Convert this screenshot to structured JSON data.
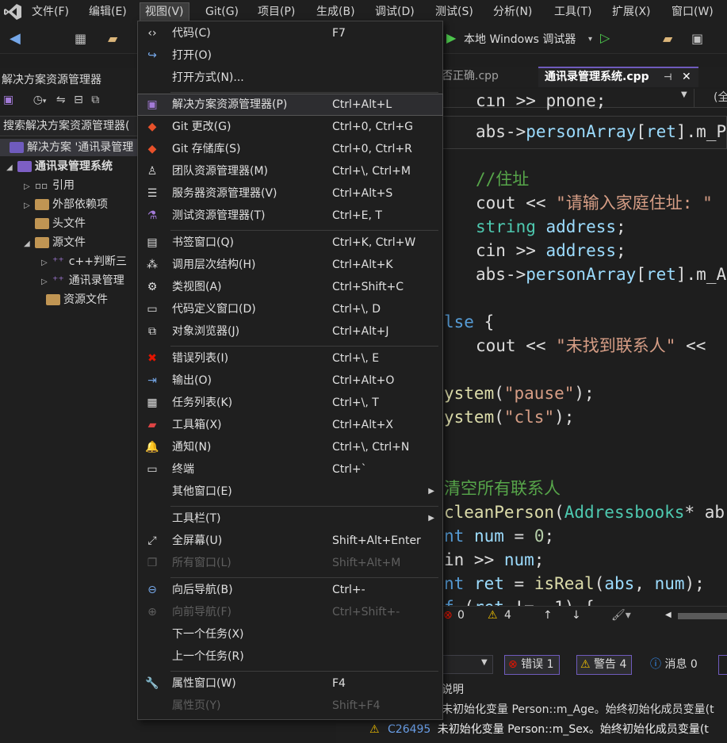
{
  "menubar": {
    "items": [
      "文件(F)",
      "编辑(E)",
      "视图(V)",
      "Git(G)",
      "项目(P)",
      "生成(B)",
      "调试(D)",
      "测试(S)",
      "分析(N)",
      "工具(T)",
      "扩展(X)",
      "窗口(W)"
    ],
    "active": "视图(V)"
  },
  "toolbar": {
    "debug_target": "本地 Windows 调试器"
  },
  "solution_explorer": {
    "title": "解决方案资源管理器",
    "search": "搜索解决方案资源管理器(",
    "tree": [
      {
        "label": "解决方案 '通讯录管理",
        "level": 0
      },
      {
        "label": "通讯录管理系统",
        "level": 1
      },
      {
        "label": "引用",
        "level": 2
      },
      {
        "label": "外部依赖项",
        "level": 2
      },
      {
        "label": "头文件",
        "level": 2
      },
      {
        "label": "源文件",
        "level": 2
      },
      {
        "label": "c++判断三",
        "level": 3
      },
      {
        "label": "通讯录管理",
        "level": 3
      },
      {
        "label": "资源文件",
        "level": 2
      }
    ]
  },
  "editor": {
    "tabs": [
      {
        "label": "否正确.cpp"
      },
      {
        "label": "通讯录管理系统.cpp"
      }
    ],
    "scope_right": "(全"
  },
  "error_bar": {
    "errors": "0",
    "warnings": "4"
  },
  "error_list": {
    "errors_btn": "错误 1",
    "warnings_btn": "警告 4",
    "messages_btn": "消息 0",
    "column_desc": "说明",
    "rows": [
      {
        "code": "",
        "desc": "未初始化变量 Person::m_Age。始终初始化成员变量(t"
      },
      {
        "code": "C26495",
        "desc": "未初始化变量 Person::m_Sex。始终初始化成员变量(t"
      }
    ]
  },
  "view_menu": {
    "items": [
      {
        "icon": "code-icon",
        "glyph": "‹›",
        "label": "代码(C)",
        "shortcut": "F7",
        "disabled": false
      },
      {
        "icon": "open-icon",
        "glyph": "↪",
        "label": "打开(O)",
        "shortcut": "",
        "disabled": false
      },
      {
        "icon": "",
        "glyph": "",
        "label": "打开方式(N)...",
        "shortcut": "",
        "disabled": false
      },
      {
        "sep": true
      },
      {
        "icon": "solution-explorer-icon",
        "glyph": "▣",
        "label": "解决方案资源管理器(P)",
        "shortcut": "Ctrl+Alt+L",
        "disabled": false,
        "highlight": true
      },
      {
        "icon": "git-changes-icon",
        "glyph": "◆",
        "label": "Git 更改(G)",
        "shortcut": "Ctrl+0, Ctrl+G",
        "disabled": false
      },
      {
        "icon": "git-repo-icon",
        "glyph": "◆",
        "label": "Git 存储库(S)",
        "shortcut": "Ctrl+0, Ctrl+R",
        "disabled": false
      },
      {
        "icon": "team-explorer-icon",
        "glyph": "♙",
        "label": "团队资源管理器(M)",
        "shortcut": "Ctrl+\\, Ctrl+M",
        "disabled": false
      },
      {
        "icon": "server-explorer-icon",
        "glyph": "☰",
        "label": "服务器资源管理器(V)",
        "shortcut": "Ctrl+Alt+S",
        "disabled": false
      },
      {
        "icon": "test-explorer-icon",
        "glyph": "⚗",
        "label": "测试资源管理器(T)",
        "shortcut": "Ctrl+E, T",
        "disabled": false
      },
      {
        "sep": true
      },
      {
        "icon": "bookmark-icon",
        "glyph": "▤",
        "label": "书签窗口(Q)",
        "shortcut": "Ctrl+K, Ctrl+W",
        "disabled": false
      },
      {
        "icon": "call-hierarchy-icon",
        "glyph": "⁂",
        "label": "调用层次结构(H)",
        "shortcut": "Ctrl+Alt+K",
        "disabled": false
      },
      {
        "icon": "class-view-icon",
        "glyph": "⚙",
        "label": "类视图(A)",
        "shortcut": "Ctrl+Shift+C",
        "disabled": false
      },
      {
        "icon": "code-definition-icon",
        "glyph": "▭",
        "label": "代码定义窗口(D)",
        "shortcut": "Ctrl+\\, D",
        "disabled": false
      },
      {
        "icon": "object-browser-icon",
        "glyph": "⧉",
        "label": "对象浏览器(J)",
        "shortcut": "Ctrl+Alt+J",
        "disabled": false
      },
      {
        "sep": true
      },
      {
        "icon": "error-list-icon",
        "glyph": "✖",
        "label": "错误列表(I)",
        "shortcut": "Ctrl+\\, E",
        "disabled": false
      },
      {
        "icon": "output-icon",
        "glyph": "⇥",
        "label": "输出(O)",
        "shortcut": "Ctrl+Alt+O",
        "disabled": false
      },
      {
        "icon": "task-list-icon",
        "glyph": "▦",
        "label": "任务列表(K)",
        "shortcut": "Ctrl+\\, T",
        "disabled": false
      },
      {
        "icon": "toolbox-icon",
        "glyph": "▰",
        "label": "工具箱(X)",
        "shortcut": "Ctrl+Alt+X",
        "disabled": false
      },
      {
        "icon": "bell-icon",
        "glyph": "🔔",
        "label": "通知(N)",
        "shortcut": "Ctrl+\\, Ctrl+N",
        "disabled": false
      },
      {
        "icon": "terminal-icon",
        "glyph": "▭",
        "label": "终端",
        "shortcut": "Ctrl+`",
        "disabled": false
      },
      {
        "icon": "",
        "glyph": "",
        "label": "其他窗口(E)",
        "shortcut": "",
        "disabled": false,
        "submenu": true
      },
      {
        "sep": true
      },
      {
        "icon": "",
        "glyph": "",
        "label": "工具栏(T)",
        "shortcut": "",
        "disabled": false,
        "submenu": true
      },
      {
        "icon": "fullscreen-icon",
        "glyph": "⤢",
        "label": "全屏幕(U)",
        "shortcut": "Shift+Alt+Enter",
        "disabled": false
      },
      {
        "icon": "all-windows-icon",
        "glyph": "❐",
        "label": "所有窗口(L)",
        "shortcut": "Shift+Alt+M",
        "disabled": true
      },
      {
        "sep": true
      },
      {
        "icon": "navigate-back-icon",
        "glyph": "⊖",
        "label": "向后导航(B)",
        "shortcut": "Ctrl+-",
        "disabled": false
      },
      {
        "icon": "navigate-forward-icon",
        "glyph": "⊕",
        "label": "向前导航(F)",
        "shortcut": "Ctrl+Shift+-",
        "disabled": true
      },
      {
        "icon": "",
        "glyph": "",
        "label": "下一个任务(X)",
        "shortcut": "",
        "disabled": false
      },
      {
        "icon": "",
        "glyph": "",
        "label": "上一个任务(R)",
        "shortcut": "",
        "disabled": false
      },
      {
        "sep": true
      },
      {
        "icon": "wrench-icon",
        "glyph": "🔧",
        "label": "属性窗口(W)",
        "shortcut": "F4",
        "disabled": false
      },
      {
        "icon": "",
        "glyph": "",
        "label": "属性页(Y)",
        "shortcut": "Shift+F4",
        "disabled": true
      }
    ]
  },
  "colors": {
    "accent": "#6f5bbd",
    "menu_bg": "#1f1f1f",
    "editor_bg": "#1e1e1e"
  }
}
